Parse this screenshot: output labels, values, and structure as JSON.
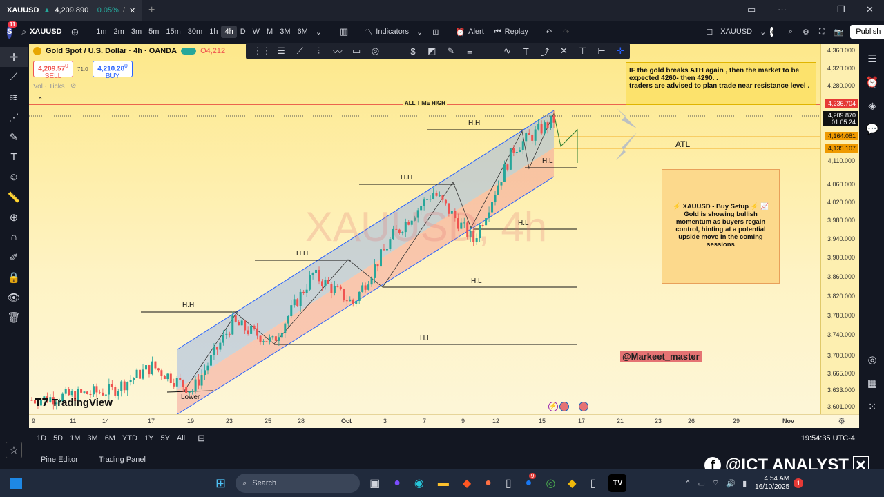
{
  "browser": {
    "tab_title": "XAUUSD",
    "tab_price": "4,209.890",
    "tab_change": "+0.05%",
    "tab_extra": "/",
    "new_tab": "+",
    "publish": "Publish"
  },
  "toolbar": {
    "avatar_letter": "S",
    "avatar_badge": "11",
    "symbol": "XAUUSD",
    "intervals": [
      "1m",
      "2m",
      "3m",
      "5m",
      "15m",
      "30m",
      "1h",
      "4h",
      "D",
      "W",
      "M",
      "3M",
      "6M"
    ],
    "active_interval": "4h",
    "indicators": "Indicators",
    "alert": "Alert",
    "replay": "Replay",
    "right_symbol": "XAUUSD",
    "right_symbol_close": "x"
  },
  "chart": {
    "instrument": "Gold Spot / U.S. Dollar · 4h · OANDA",
    "ohlc_open": "O4,212",
    "sell_price": "4,209.57",
    "sell_sup": "0",
    "sell_label": "SELL",
    "spread": "71.0",
    "buy_price": "4,210.28",
    "buy_sup": "0",
    "buy_label": "BUY",
    "vol_label": "Vol · Ticks",
    "watermark": "XAUUSD, 4h",
    "logo": "TradingView",
    "all_time_high": "ALL TIME HIGH",
    "atl": "ATL",
    "username": "@Markeet_master",
    "top_note": "IF the gold breaks ATH again , then the market  to be expected 4260- then 4290. .\ntraders are advised to plan trade near resistance level .",
    "setup_title": "XAUUSD - Buy Setup",
    "setup_body": "Gold is showing bullish momentum as buyers regain control, hinting at a potential upside move in the coming sessions",
    "labels": [
      "H.H",
      "H.H",
      "H.H",
      "H.H",
      "H.L",
      "H.L",
      "H.L",
      "H.L",
      "Lower"
    ],
    "price_axis": [
      "4,360.000",
      "4,320.000",
      "4,280.000",
      "4,110.000",
      "4,060.000",
      "4,020.000",
      "3,980.000",
      "3,940.000",
      "3,900.000",
      "3,860.000",
      "3,820.000",
      "3,780.000",
      "3,740.000",
      "3,700.000",
      "3,665.000",
      "3,633.000",
      "3,601.000"
    ],
    "badge_ath": "4,236.704",
    "badge_current": "4,209.870",
    "badge_countdown": "01:05:24",
    "badge_1": "4,164.081",
    "badge_2": "4,135.107",
    "time_axis": [
      "9",
      "11",
      "14",
      "17",
      "19",
      "23",
      "25",
      "28",
      "Oct",
      "3",
      "7",
      "9",
      "12",
      "15",
      "17",
      "21",
      "23",
      "26",
      "29",
      "Nov"
    ]
  },
  "bottom": {
    "ranges": [
      "1D",
      "5D",
      "1M",
      "3M",
      "6M",
      "YTD",
      "1Y",
      "5Y",
      "All"
    ],
    "clock": "19:54:35 UTC-4",
    "pine_editor": "Pine Editor",
    "trading_panel": "Trading Panel"
  },
  "overlay": {
    "brand": "@ICT ANALYST"
  },
  "taskbar": {
    "search": "Search",
    "time": "4:54 AM",
    "date": "16/10/2025",
    "notif": "1",
    "badge_9": "9"
  },
  "chart_data": {
    "type": "line",
    "title": "",
    "x": [
      "9",
      "11",
      "14",
      "17",
      "19",
      "23",
      "25",
      "28",
      "Oct",
      "3",
      "7",
      "9",
      "12",
      "15"
    ],
    "series": [
      {
        "values": [
          3630,
          3640,
          3650,
          3700,
          3650,
          3790,
          3750,
          3890,
          3830,
          3970,
          4060,
          3960,
          4150,
          4209
        ]
      }
    ],
    "ylim": [
      3601,
      4360
    ],
    "grid": false
  },
  "colors": {
    "up": "#26a69a",
    "down": "#ef5350",
    "channel_blue": "#2962ff",
    "ath_line": "#e53935"
  }
}
